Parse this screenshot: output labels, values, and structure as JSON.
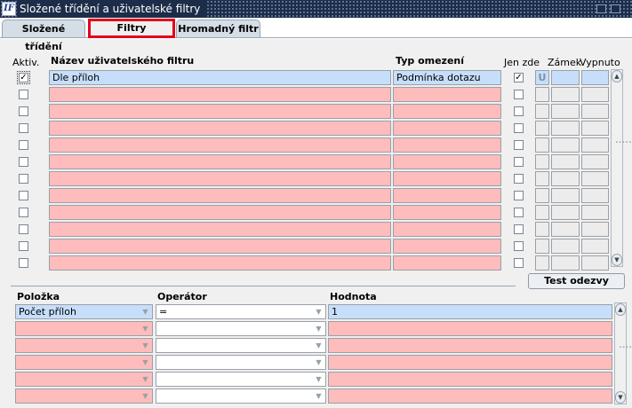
{
  "window": {
    "title": "Složené třídění a uživatelské filtry",
    "app_icon": "IF"
  },
  "tabs": [
    {
      "label": "Složené třídění"
    },
    {
      "label": "Filtry",
      "active": true
    },
    {
      "label": "Hromadný filtr"
    }
  ],
  "filters": {
    "headers": {
      "active": "Aktiv.",
      "name": "Název uživatelského filtru",
      "type": "Typ omezení",
      "local": "Jen zde",
      "lock": "Zámek",
      "off": "Vypnuto"
    },
    "rows": [
      {
        "active": true,
        "name": "Dle příloh",
        "type": "Podmínka dotazu",
        "local": true,
        "lock": "U",
        "off": ""
      },
      {
        "active": false,
        "name": "",
        "type": "",
        "local": false,
        "lock": "",
        "off": ""
      },
      {
        "active": false,
        "name": "",
        "type": "",
        "local": false,
        "lock": "",
        "off": ""
      },
      {
        "active": false,
        "name": "",
        "type": "",
        "local": false,
        "lock": "",
        "off": ""
      },
      {
        "active": false,
        "name": "",
        "type": "",
        "local": false,
        "lock": "",
        "off": ""
      },
      {
        "active": false,
        "name": "",
        "type": "",
        "local": false,
        "lock": "",
        "off": ""
      },
      {
        "active": false,
        "name": "",
        "type": "",
        "local": false,
        "lock": "",
        "off": ""
      },
      {
        "active": false,
        "name": "",
        "type": "",
        "local": false,
        "lock": "",
        "off": ""
      },
      {
        "active": false,
        "name": "",
        "type": "",
        "local": false,
        "lock": "",
        "off": ""
      },
      {
        "active": false,
        "name": "",
        "type": "",
        "local": false,
        "lock": "",
        "off": ""
      },
      {
        "active": false,
        "name": "",
        "type": "",
        "local": false,
        "lock": "",
        "off": ""
      },
      {
        "active": false,
        "name": "",
        "type": "",
        "local": false,
        "lock": "",
        "off": ""
      }
    ],
    "check_glyph": "✓"
  },
  "test_button": "Test odezvy",
  "conditions": {
    "headers": {
      "item": "Položka",
      "operator": "Operátor",
      "value": "Hodnota"
    },
    "rows": [
      {
        "item": "Počet příloh",
        "operator": "=",
        "value": "1"
      },
      {
        "item": "",
        "operator": "",
        "value": ""
      },
      {
        "item": "",
        "operator": "",
        "value": ""
      },
      {
        "item": "",
        "operator": "",
        "value": ""
      },
      {
        "item": "",
        "operator": "",
        "value": ""
      },
      {
        "item": "",
        "operator": "",
        "value": ""
      }
    ]
  },
  "icons": {
    "scroll_up": "▲",
    "scroll_down": "▼",
    "combo_arrow": "▼",
    "grip": "∙∙∙∙∙∙"
  },
  "colors": {
    "required_field": "#ffbcbc",
    "selected_field": "#c6defa",
    "titlebar": "#1c2d49",
    "active_tab_highlight": "#e3001b"
  }
}
